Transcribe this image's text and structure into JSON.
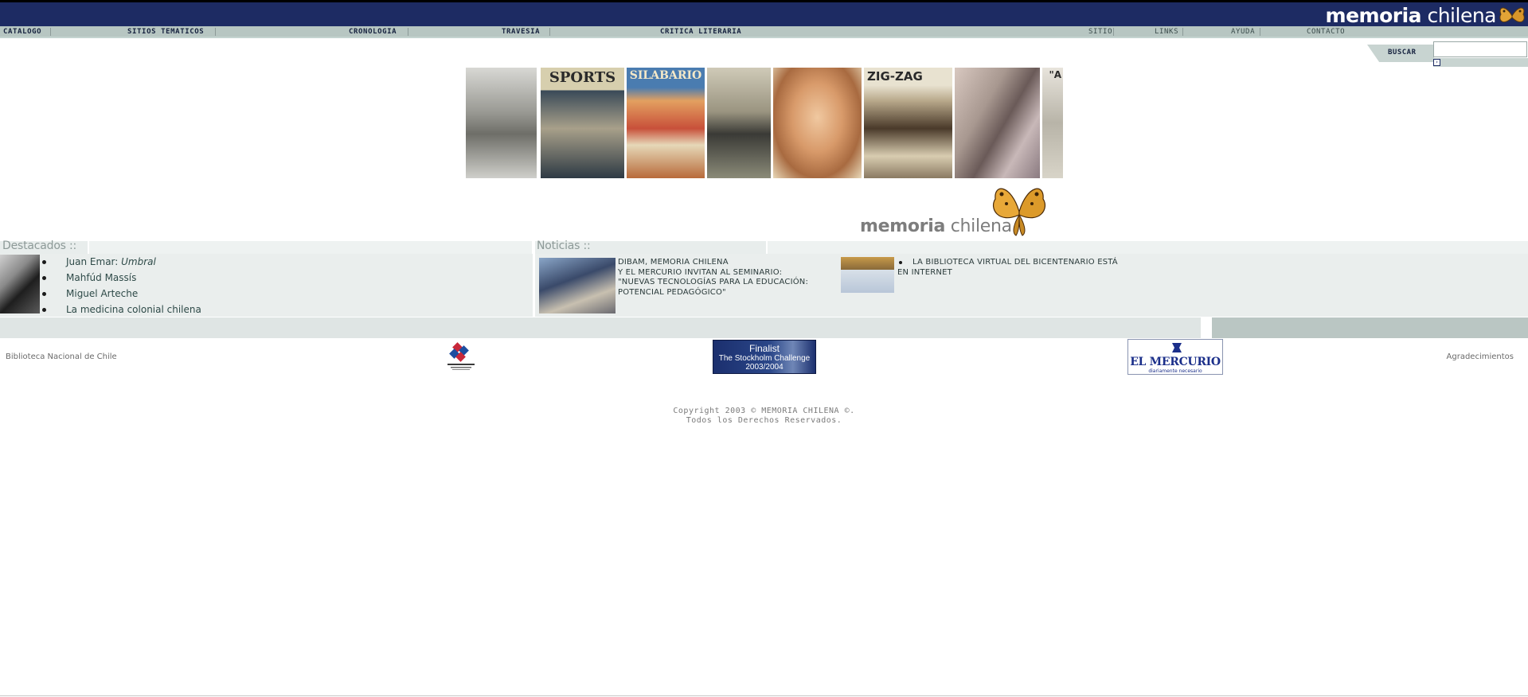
{
  "brand": {
    "bold": "memoria",
    "light": " chilena"
  },
  "nav": {
    "left": [
      "CATALOGO",
      "SITIOS TEMATICOS",
      "CRONOLOGIA",
      "TRAVESIA",
      "CRITICA LITERARIA"
    ],
    "right": [
      "SITIO",
      "LINKS",
      "AYUDA",
      "CONTACTO"
    ]
  },
  "search": {
    "label": "BUSCAR",
    "value": ""
  },
  "mosaic": {
    "photos": [
      {
        "title": ""
      },
      {
        "title": "SPORTS"
      },
      {
        "title": "SILABARIO"
      },
      {
        "title": ""
      },
      {
        "title": ""
      },
      {
        "title": "ZIG-ZAG"
      },
      {
        "title": ""
      },
      {
        "title": "\"A"
      }
    ],
    "logo_bold": "memoria",
    "logo_light": " chilena"
  },
  "destacados": {
    "title": "Destacados ::",
    "items": [
      {
        "plain": "Juan Emar: ",
        "italic": "Umbral"
      },
      {
        "plain": "Mahfúd Massís",
        "italic": ""
      },
      {
        "plain": "Miguel Arteche",
        "italic": ""
      },
      {
        "plain": "La medicina colonial chilena",
        "italic": ""
      }
    ]
  },
  "noticias": {
    "title": "Noticias ::",
    "news1": [
      "DIBAM, MEMORIA CHILENA",
      "Y EL MERCURIO INVITAN AL SEMINARIO:",
      "\"NUEVAS TECNOLOGÍAS PARA LA EDUCACIÓN:",
      "POTENCIAL PEDAGÓGICO\""
    ],
    "news2": [
      "LA BIBLIOTECA VIRTUAL DEL BICENTENARIO ESTÁ",
      "EN INTERNET"
    ]
  },
  "footer": {
    "left": "Biblioteca Nacional de Chile",
    "right": "Agradecimientos",
    "finalist": [
      "Finalist",
      "The Stockholm Challenge",
      "2003/2004"
    ],
    "mercurio": {
      "name": "EL MERCURIO",
      "tagline": "diariamente necesario"
    }
  },
  "copyright": [
    "Copyright 2003 © MEMORIA CHILENA ©.",
    "Todos los Derechos Reservados."
  ],
  "colors": {
    "header": "#1d2b63",
    "nav": "#b7c6c2",
    "panel": "#eaeeed",
    "band": "#bac6c3"
  }
}
